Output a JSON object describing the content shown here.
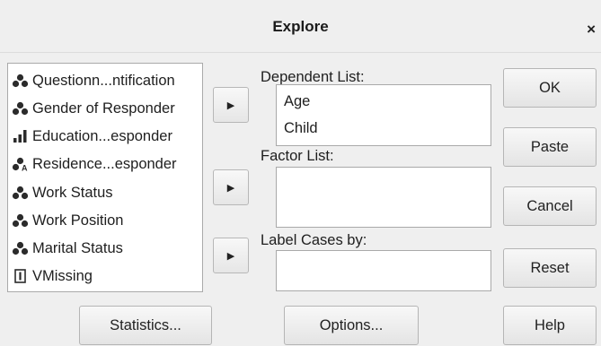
{
  "dialog": {
    "title": "Explore",
    "close_label": "×"
  },
  "variables": [
    {
      "label": "Questionn...ntification",
      "icon": "nominal-icon"
    },
    {
      "label": "Gender of Responder",
      "icon": "nominal-icon"
    },
    {
      "label": "Education...esponder",
      "icon": "ordinal-icon"
    },
    {
      "label": "Residence...esponder",
      "icon": "nominal-string-icon"
    },
    {
      "label": "Work Status",
      "icon": "nominal-icon"
    },
    {
      "label": "Work Position",
      "icon": "nominal-icon"
    },
    {
      "label": "Marital Status",
      "icon": "nominal-icon"
    },
    {
      "label": "VMissing",
      "icon": "string-icon"
    }
  ],
  "dependent": {
    "label": "Dependent List:",
    "items": [
      "Age",
      "Child"
    ]
  },
  "factor": {
    "label": "Factor List:"
  },
  "labelcases": {
    "label": "Label Cases by:"
  },
  "buttons": {
    "ok": "OK",
    "paste": "Paste",
    "cancel": "Cancel",
    "reset": "Reset",
    "help": "Help",
    "statistics": "Statistics...",
    "options": "Options..."
  },
  "colors": {
    "dialog_bg": "#efefef",
    "list_bg": "#ffffff",
    "icon_dark": "#2b2b2b"
  }
}
